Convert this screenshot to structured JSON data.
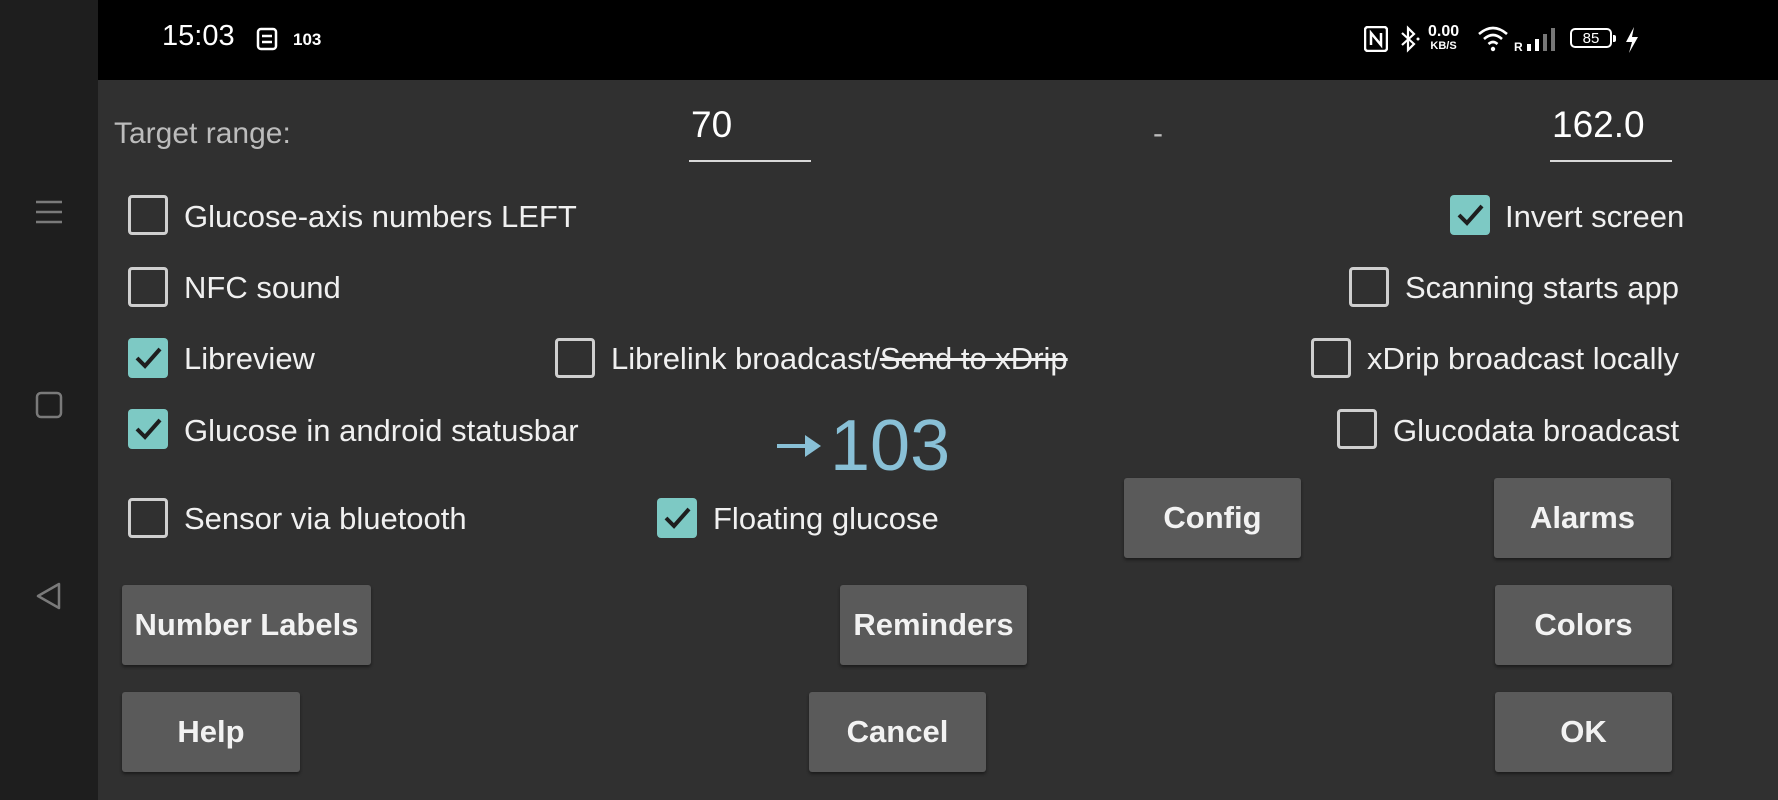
{
  "statusbar": {
    "time": "15:03",
    "notification_value": "103",
    "net_speed": "0.00",
    "net_unit": "KB/S",
    "signal_roaming": "R",
    "battery": "85"
  },
  "target_range": {
    "label": "Target range:",
    "low": "70",
    "separator": "-",
    "high": "162.0"
  },
  "options": {
    "glucose_axis_left": {
      "label": "Glucose-axis numbers LEFT",
      "checked": false
    },
    "invert_screen": {
      "label": "Invert screen",
      "checked": true
    },
    "nfc_sound": {
      "label": "NFC sound",
      "checked": false
    },
    "scanning_starts_app": {
      "label": "Scanning starts app",
      "checked": false
    },
    "libreview": {
      "label": "Libreview",
      "checked": true
    },
    "librelink_broadcast": {
      "label_main": "Librelink broadcast/",
      "label_struck": "Send to xDrip",
      "checked": false
    },
    "xdrip_broadcast_locally": {
      "label": "xDrip broadcast locally",
      "checked": false
    },
    "glucose_statusbar": {
      "label": "Glucose in android statusbar",
      "checked": true
    },
    "glucodata_broadcast": {
      "label": "Glucodata broadcast",
      "checked": false
    },
    "sensor_bluetooth": {
      "label": "Sensor via bluetooth",
      "checked": false
    },
    "floating_glucose": {
      "label": "Floating glucose",
      "checked": true
    }
  },
  "floating_glucose_display": {
    "value": "103",
    "trend": "arrow-right",
    "color": "#89c0d6"
  },
  "buttons": {
    "config": "Config",
    "alarms": "Alarms",
    "number_labels": "Number Labels",
    "reminders": "Reminders",
    "colors": "Colors",
    "help": "Help",
    "cancel": "Cancel",
    "ok": "OK"
  },
  "theme": {
    "background": "#303030",
    "accent": "#7dc9c4",
    "button": "#5a5a5a"
  }
}
